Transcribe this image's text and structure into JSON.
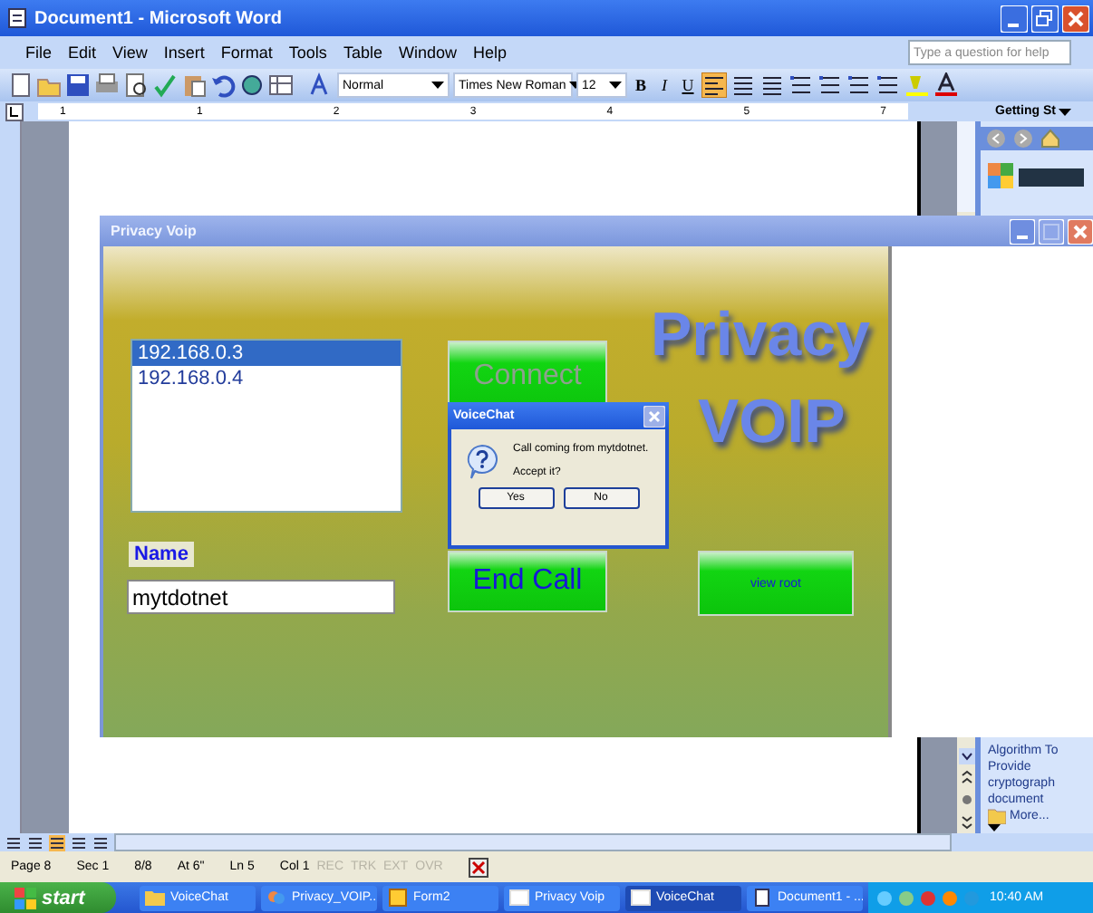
{
  "word": {
    "title": "Document1 - Microsoft Word",
    "menu": [
      "File",
      "Edit",
      "View",
      "Insert",
      "Format",
      "Tools",
      "Table",
      "Window",
      "Help"
    ],
    "help_placeholder": "Type a question for help",
    "toolbar": {
      "style": "Normal",
      "font": "Times New Roman",
      "size": "12",
      "format_buttons": [
        "B",
        "I",
        "U"
      ],
      "alignment": [
        {
          "selected": true
        },
        {
          "selected": false
        },
        {
          "selected": false
        }
      ]
    },
    "ruler": [
      "1",
      "1",
      "2",
      "3",
      "4",
      "5",
      "7"
    ],
    "task_pane": {
      "title": "Getting St",
      "items": [
        "Algorithm To",
        "Provide",
        "cryptograph",
        "document"
      ],
      "more": "More..."
    },
    "status_bar": {
      "fields": [
        "Page 8",
        "Sec 1",
        "8/8",
        "At 6\"",
        "Ln 5",
        "Col 1"
      ],
      "modes": [
        {
          "label": "REC",
          "disabled": true
        },
        {
          "label": "TRK",
          "disabled": true
        },
        {
          "label": "EXT",
          "disabled": true
        },
        {
          "label": "OVR",
          "disabled": true
        }
      ]
    }
  },
  "voip_window": {
    "title": "Privacy Voip",
    "hosts": [
      {
        "label": "192.168.0.3",
        "selected": true
      },
      {
        "label": "192.168.0.4",
        "selected": false
      }
    ],
    "connect": {
      "label": "Connect",
      "disabled": true
    },
    "end_call": {
      "label": "End Call",
      "disabled": false
    },
    "view_root": {
      "label": "view root",
      "disabled": false
    },
    "name_label": "Name",
    "name_value": "mytdotnet",
    "logo": [
      "Privacy",
      "VOIP"
    ]
  },
  "dialog": {
    "title": "VoiceChat",
    "message": "Call coming from mytdotnet.",
    "question": "Accept it?",
    "buttons": [
      "Yes",
      "No"
    ]
  },
  "taskbar": {
    "start": "start",
    "tasks": [
      {
        "label": "VoiceChat",
        "selected": false
      },
      {
        "label": "Privacy_VOIP...",
        "selected": false
      },
      {
        "label": "Form2",
        "selected": false
      },
      {
        "label": "Privacy Voip",
        "selected": false
      },
      {
        "label": "VoiceChat",
        "selected": true
      },
      {
        "label": "Document1 - ...",
        "selected": false
      }
    ],
    "clock": "10:40 AM"
  }
}
